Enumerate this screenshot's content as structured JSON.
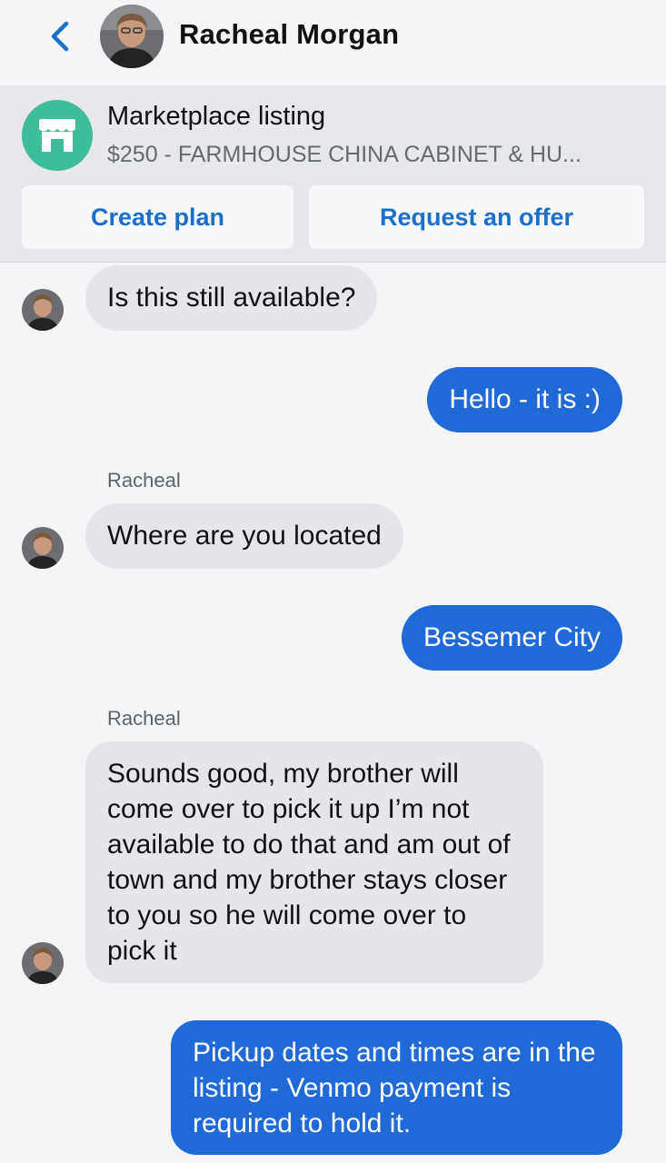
{
  "header": {
    "contact_name": "Racheal Morgan",
    "back_icon": "chevron-left-icon"
  },
  "listing": {
    "icon": "storefront-icon",
    "title": "Marketplace listing",
    "subtitle": "$250 - FARMHOUSE CHINA CABINET & HU...",
    "create_plan_label": "Create plan",
    "request_offer_label": "Request an offer"
  },
  "messages": [
    {
      "direction": "incoming",
      "sender": "",
      "text": "Is this still available?"
    },
    {
      "direction": "outgoing",
      "text": "Hello - it is :)"
    },
    {
      "direction": "incoming",
      "sender": "Racheal",
      "text": "Where are you located"
    },
    {
      "direction": "outgoing",
      "text": "Bessemer City"
    },
    {
      "direction": "incoming",
      "sender": "Racheal",
      "text": "Sounds good, my brother will come over to pick it up I’m not available to do that and am out of town and my brother stays closer to you so he will come over to pick it"
    },
    {
      "direction": "outgoing",
      "text": "Pickup dates and times are in the listing - Venmo payment is required to hold it."
    }
  ],
  "colors": {
    "accent_blue": "#1c6ec7",
    "outgoing_bubble": "#1f6ad6",
    "incoming_bubble": "#e4e6ea",
    "marketplace_green": "#3fbc9a"
  }
}
